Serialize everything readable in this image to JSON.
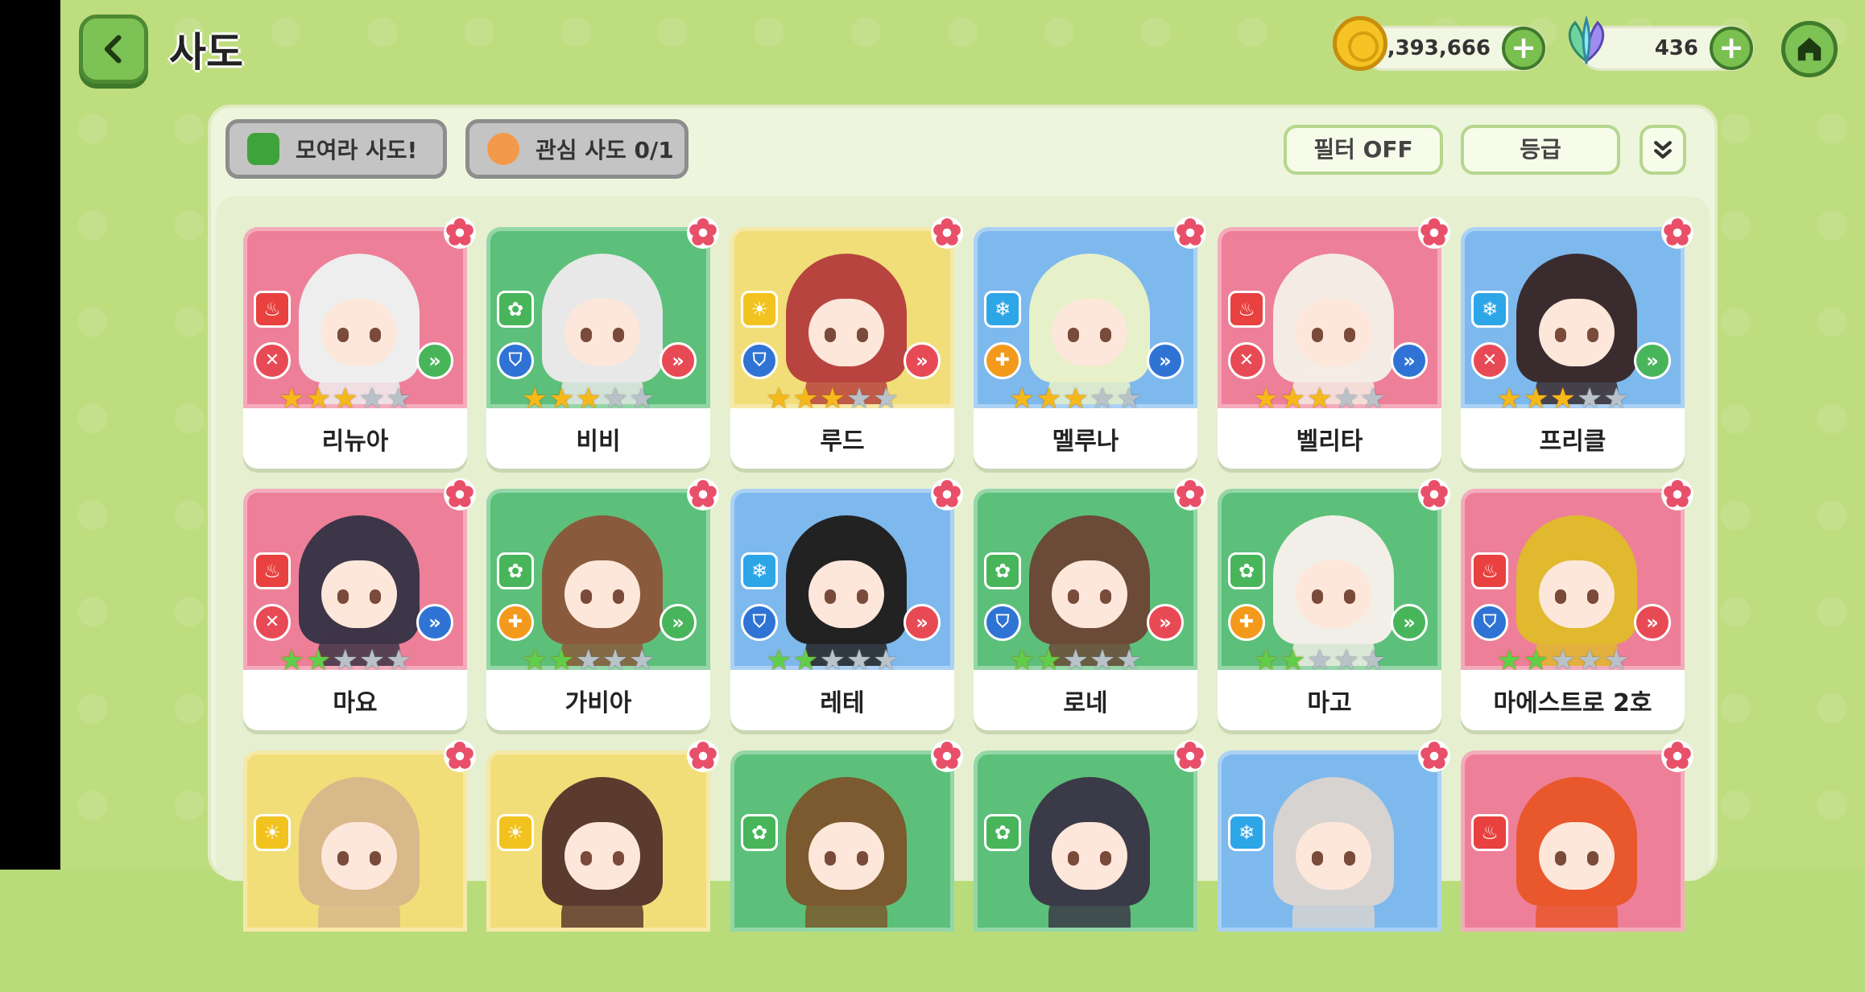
{
  "header": {
    "title": "사도",
    "gold": "2,393,666",
    "gems": "436"
  },
  "tabs": {
    "collect": "모여라 사도!",
    "favorite": "관심 사도  0/1"
  },
  "options": {
    "filter": "필터 OFF",
    "sort": "등급"
  },
  "colors": {
    "red": "#ee7f98",
    "green": "#5cc07a",
    "yellow": "#f1de78",
    "blue": "#7eb9ee",
    "fire": "#e8413f",
    "nature": "#48b55b",
    "light": "#f2c31e",
    "ice": "#2da6e8",
    "roleRed": "#e84a55",
    "roleBlue": "#2f74d4",
    "roleOrange": "#f39a1c"
  },
  "cards": [
    {
      "name": "리뉴아",
      "bg": "red",
      "element": "fire",
      "role": "red",
      "arrow": "green",
      "stars": 3
    },
    {
      "name": "비비",
      "bg": "green",
      "element": "nature",
      "role": "blue",
      "arrow": "red",
      "stars": 3
    },
    {
      "name": "루드",
      "bg": "yellow",
      "element": "light",
      "role": "blue",
      "arrow": "red",
      "stars": 3
    },
    {
      "name": "멜루나",
      "bg": "blue",
      "element": "ice",
      "role": "orange",
      "arrow": "blue",
      "stars": 3
    },
    {
      "name": "벨리타",
      "bg": "red",
      "element": "fire",
      "role": "red",
      "arrow": "blue",
      "stars": 3
    },
    {
      "name": "프리클",
      "bg": "blue",
      "element": "ice",
      "role": "red",
      "arrow": "green",
      "stars": 3
    },
    {
      "name": "마요",
      "bg": "red",
      "element": "fire",
      "role": "red",
      "arrow": "blue",
      "stars": 2
    },
    {
      "name": "가비아",
      "bg": "green",
      "element": "nature",
      "role": "orange",
      "arrow": "green",
      "stars": 2
    },
    {
      "name": "레테",
      "bg": "blue",
      "element": "ice",
      "role": "blue",
      "arrow": "red",
      "stars": 2
    },
    {
      "name": "로네",
      "bg": "green",
      "element": "nature",
      "role": "blue",
      "arrow": "red",
      "stars": 2
    },
    {
      "name": "마고",
      "bg": "green",
      "element": "nature",
      "role": "orange",
      "arrow": "green",
      "stars": 2
    },
    {
      "name": "마에스트로 2호",
      "bg": "red",
      "element": "fire",
      "role": "blue",
      "arrow": "red",
      "stars": 2
    },
    {
      "name": "",
      "bg": "yellow",
      "element": "light",
      "role": "",
      "arrow": "",
      "stars": 0
    },
    {
      "name": "",
      "bg": "yellow",
      "element": "light",
      "role": "",
      "arrow": "",
      "stars": 0
    },
    {
      "name": "",
      "bg": "green",
      "element": "nature",
      "role": "",
      "arrow": "",
      "stars": 0
    },
    {
      "name": "",
      "bg": "green",
      "element": "nature",
      "role": "",
      "arrow": "",
      "stars": 0
    },
    {
      "name": "",
      "bg": "blue",
      "element": "ice",
      "role": "",
      "arrow": "",
      "stars": 0
    },
    {
      "name": "",
      "bg": "red",
      "element": "fire",
      "role": "",
      "arrow": "",
      "stars": 0
    }
  ]
}
